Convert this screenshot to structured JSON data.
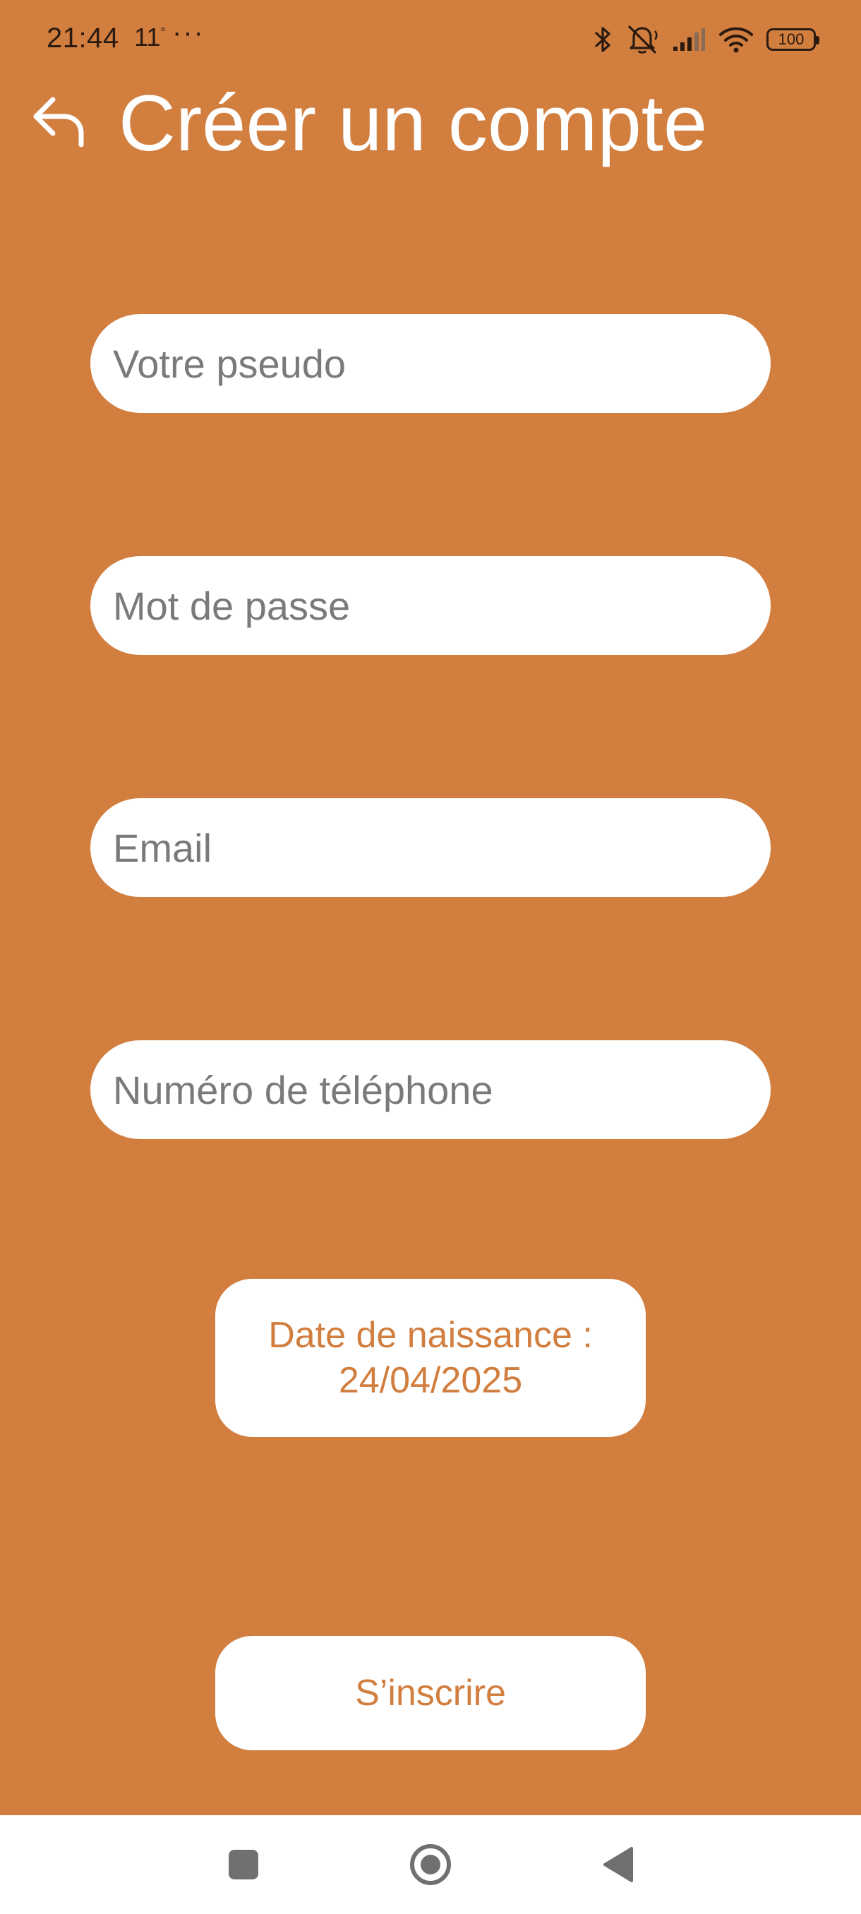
{
  "status_bar": {
    "time": "21:44",
    "temperature": "11",
    "temperature_unit": "°",
    "more": "···",
    "battery_level": "100"
  },
  "header": {
    "back_icon": "back-arrow-icon",
    "title": "Créer un compte"
  },
  "form": {
    "pseudo_placeholder": "Votre pseudo",
    "password_placeholder": "Mot de passe",
    "email_placeholder": "Email",
    "phone_placeholder": "Numéro de téléphone",
    "birthdate_label": "Date de naissance :",
    "birthdate_value": "24/04/2025",
    "submit_label": "S’inscrire"
  },
  "nav_bar": {
    "recents_icon": "square-icon",
    "home_icon": "circle-home-icon",
    "back_icon": "triangle-back-icon"
  },
  "colors": {
    "background": "#D17E3F",
    "field_background": "#FFFFFF",
    "button_text": "#D17E3F",
    "placeholder_text": "#7A7A7A"
  }
}
